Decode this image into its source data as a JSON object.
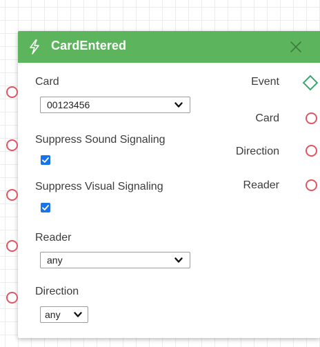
{
  "node": {
    "title": "CardEntered",
    "header_icon": "lightning-icon",
    "close_icon": "close-icon",
    "colors": {
      "header": "#5cb55c",
      "input_port": "#e05561",
      "event_port": "#3aa571",
      "checkbox": "#1a73e8"
    }
  },
  "inputs": {
    "card": {
      "label": "Card",
      "value": "00123456"
    },
    "suppress_sound": {
      "label": "Suppress Sound Signaling",
      "checked": true
    },
    "suppress_visual": {
      "label": "Suppress Visual Signaling",
      "checked": true
    },
    "reader": {
      "label": "Reader",
      "value": "any"
    },
    "direction": {
      "label": "Direction",
      "value": "any"
    }
  },
  "outputs": {
    "event": "Event",
    "card": "Card",
    "direction": "Direction",
    "reader": "Reader"
  }
}
